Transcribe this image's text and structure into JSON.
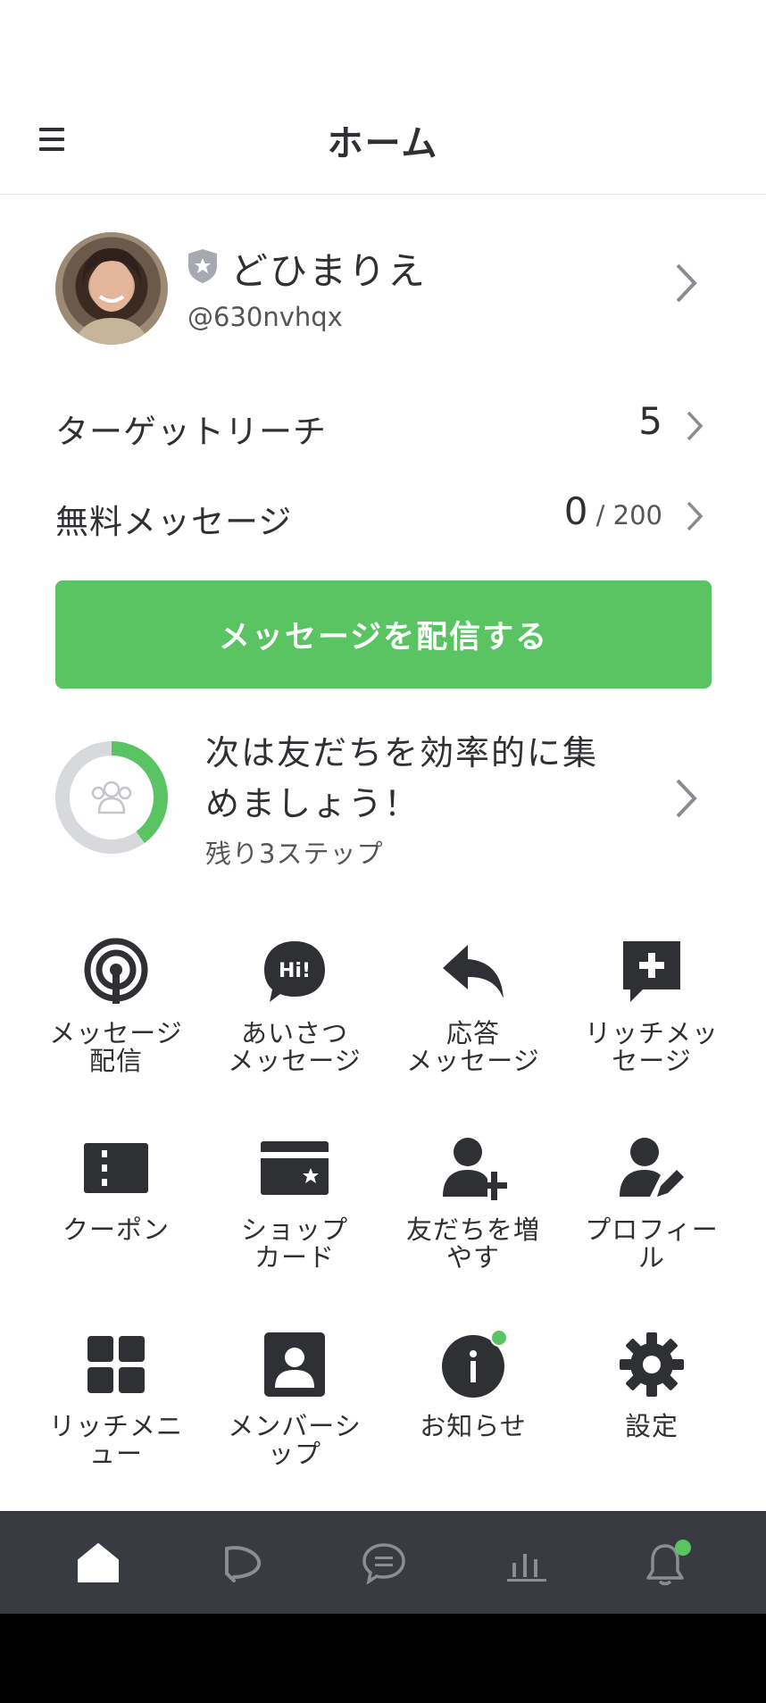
{
  "header": {
    "title": "ホーム"
  },
  "profile": {
    "name": "どひまりえ",
    "handle": "@630nvhqx"
  },
  "stats": [
    {
      "label": "ターゲットリーチ",
      "value": "5",
      "sub": ""
    },
    {
      "label": "無料メッセージ",
      "value": "0",
      "sub": " / 200"
    }
  ],
  "cta": {
    "label": "メッセージを配信する"
  },
  "progress": {
    "title": "次は友だちを効率的に集めましょう！",
    "subtitle": "残り3ステップ",
    "fraction": 0.4,
    "color": "#5ac463"
  },
  "grid": [
    {
      "label": "メッセージ\n配信",
      "icon": "broadcast-icon"
    },
    {
      "label": "あいさつ\nメッセージ",
      "icon": "greeting-icon"
    },
    {
      "label": "応答\nメッセージ",
      "icon": "reply-icon"
    },
    {
      "label": "リッチメッ\nセージ",
      "icon": "rich-message-icon"
    },
    {
      "label": "クーポン",
      "icon": "coupon-icon"
    },
    {
      "label": "ショップ\nカード",
      "icon": "shop-card-icon"
    },
    {
      "label": "友だちを増\nやす",
      "icon": "add-friend-icon"
    },
    {
      "label": "プロフィー\nル",
      "icon": "profile-edit-icon"
    },
    {
      "label": "リッチメニ\nュー",
      "icon": "rich-menu-icon"
    },
    {
      "label": "メンバーシ\nップ",
      "icon": "membership-icon"
    },
    {
      "label": "お知らせ",
      "icon": "info-icon"
    },
    {
      "label": "設定",
      "icon": "gear-icon"
    }
  ],
  "colors": {
    "accent": "#5ac463",
    "text": "#2f3033",
    "nav_bg": "#383b40"
  },
  "bottom_nav": [
    "home-icon",
    "voom-icon",
    "chat-icon",
    "analytics-icon",
    "bell-icon"
  ]
}
